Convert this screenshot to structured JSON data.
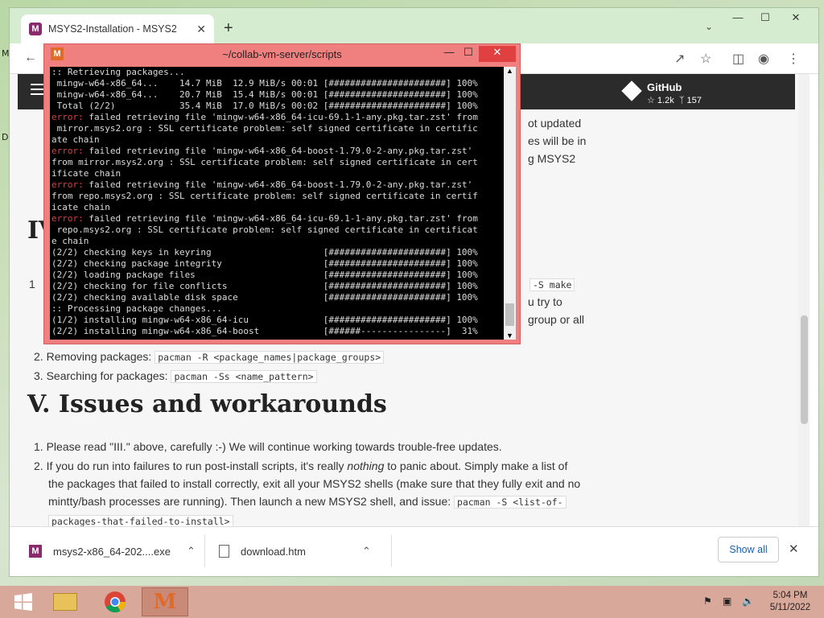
{
  "desktop": {
    "icon_labels": [
      "M",
      "D"
    ]
  },
  "browser": {
    "tab_title": "MSYS2-Installation - MSYS2",
    "tab_favicon": "M",
    "new_tab_label": "+",
    "tab_close": "✕",
    "window_controls": {
      "minimize": "—",
      "maximize": "☐",
      "close": "✕"
    }
  },
  "site": {
    "github_label": "GitHub",
    "github_stars": "1.2k",
    "github_forks": "157"
  },
  "content": {
    "frag_top": [
      "ot updated",
      "es will be in",
      "g MSYS2"
    ],
    "frag_section_head": "IV",
    "frag_item1_number": "1",
    "frag_item1_code": "-S make",
    "frag_item1_right": [
      "u try to",
      "group or all"
    ],
    "item2_label": "Removing packages: ",
    "item2_code": "pacman -R <package_names|package_groups>",
    "item3_label": "Searching for packages: ",
    "item3_code": "pacman -Ss <name_pattern>",
    "section5_title": "V. Issues and workarounds",
    "s5_item1": "Please read \"III.\" above, carefully :-) We will continue working towards trouble-free updates.",
    "s5_item2_a": "If you do run into failures to run post-install scripts, it's really ",
    "s5_item2_em": "nothing",
    "s5_item2_b": " to panic about. Simply make a list of",
    "s5_item2_line2": "the packages that failed to install correctly, exit all your MSYS2 shells (make sure that they fully exit and no",
    "s5_item2_line3": "mintty/bash processes are running). Then launch a new MSYS2 shell, and issue: ",
    "s5_item2_code1": "pacman -S <list-of-",
    "s5_item2_code2": "packages-that-failed-to-install>"
  },
  "downloads": {
    "items": [
      {
        "name": "msys2-x86_64-202....exe",
        "icon": "msys2-icon"
      },
      {
        "name": "download.htm",
        "icon": "file-icon"
      }
    ],
    "show_all": "Show all",
    "close": "✕"
  },
  "terminal": {
    "title": "~/collab-vm-server/scripts",
    "icon": "M",
    "lines": [
      [
        ":: Retrieving packages...",
        ""
      ],
      [
        " mingw-w64-x86_64...    14.7 MiB  12.9 MiB/s 00:01 [######################] 100%",
        ""
      ],
      [
        " mingw-w64-x86_64...    20.7 MiB  15.4 MiB/s 00:01 [######################] 100%",
        ""
      ],
      [
        " Total (2/2)            35.4 MiB  17.0 MiB/s 00:02 [######################] 100%",
        ""
      ],
      [
        "error:",
        " failed retrieving file 'mingw-w64-x86_64-icu-69.1-1-any.pkg.tar.zst' from"
      ],
      [
        " mirror.msys2.org : SSL certificate problem: self signed certificate in certific",
        ""
      ],
      [
        "ate chain",
        ""
      ],
      [
        "error:",
        " failed retrieving file 'mingw-w64-x86_64-boost-1.79.0-2-any.pkg.tar.zst'"
      ],
      [
        "from mirror.msys2.org : SSL certificate problem: self signed certificate in cert",
        ""
      ],
      [
        "ificate chain",
        ""
      ],
      [
        "error:",
        " failed retrieving file 'mingw-w64-x86_64-boost-1.79.0-2-any.pkg.tar.zst'"
      ],
      [
        "from repo.msys2.org : SSL certificate problem: self signed certificate in certif",
        ""
      ],
      [
        "icate chain",
        ""
      ],
      [
        "error:",
        " failed retrieving file 'mingw-w64-x86_64-icu-69.1-1-any.pkg.tar.zst' from"
      ],
      [
        " repo.msys2.org : SSL certificate problem: self signed certificate in certificat",
        ""
      ],
      [
        "e chain",
        ""
      ],
      [
        "(2/2) checking keys in keyring                     [######################] 100%",
        ""
      ],
      [
        "(2/2) checking package integrity                   [######################] 100%",
        ""
      ],
      [
        "(2/2) loading package files                        [######################] 100%",
        ""
      ],
      [
        "(2/2) checking for file conflicts                  [######################] 100%",
        ""
      ],
      [
        "(2/2) checking available disk space                [######################] 100%",
        ""
      ],
      [
        ":: Processing package changes...",
        ""
      ],
      [
        "(1/2) installing mingw-w64-x86_64-icu              [######################] 100%",
        ""
      ],
      [
        "(2/2) installing mingw-w64-x86_64-boost            [######----------------]  31%",
        ""
      ]
    ]
  },
  "taskbar": {
    "time": "5:04 PM",
    "date": "5/11/2022"
  }
}
